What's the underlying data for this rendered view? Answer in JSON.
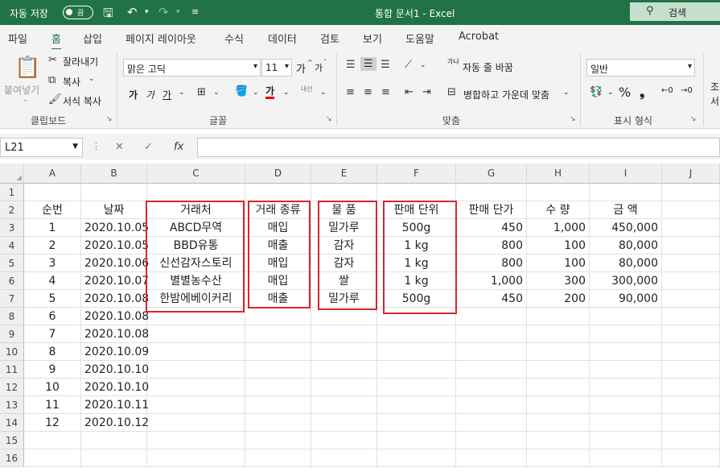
{
  "titlebar": {
    "autosave_label": "자동 저장",
    "autosave_state": "끔",
    "title": "통합 문서1  -  Excel",
    "search": "검색"
  },
  "menu": [
    "파일",
    "홈",
    "삽입",
    "페이지 레이아웃",
    "수식",
    "데이터",
    "검토",
    "보기",
    "도움말",
    "Acrobat"
  ],
  "ribbon": {
    "clipboard": {
      "paste": "붙여넣기",
      "cut": "잘라내기",
      "copy": "복사",
      "format_painter": "서식 복사",
      "group": "클립보드"
    },
    "font": {
      "name": "맑은 고딕",
      "size": "11",
      "bold": "가",
      "italic": "가",
      "underline": "가",
      "font_color": "가",
      "phonetic": "내선",
      "grow": "가",
      "shrink": "가",
      "group": "글꼴"
    },
    "alignment": {
      "wrap": "자동 줄 바꿈",
      "merge": "병합하고 가운데 맞춤",
      "orientation": "가나",
      "group": "맞춤"
    },
    "number": {
      "format": "일반",
      "group": "표시 형식"
    },
    "styles": {
      "partial1": "조",
      "partial2": "서"
    }
  },
  "formula_bar": {
    "name_box": "L21",
    "formula": ""
  },
  "sheet": {
    "columns": [
      "A",
      "B",
      "C",
      "D",
      "E",
      "F",
      "G",
      "H",
      "I",
      "J"
    ],
    "rows": [
      "1",
      "2",
      "3",
      "4",
      "5",
      "6",
      "7",
      "8",
      "9",
      "10",
      "11",
      "12",
      "13",
      "14",
      "15",
      "16"
    ],
    "headers": {
      "A": "순번",
      "B": "날짜",
      "C": "거래처",
      "D": "거래 종류",
      "E": "물 품",
      "F": "판매 단위",
      "G": "판매 단가",
      "H": "수 량",
      "I": "금 액"
    },
    "data": [
      [
        "1",
        "2020.10.05",
        "ABCD무역",
        "매입",
        "밀가루",
        "500g",
        "450",
        "1,000",
        "450,000"
      ],
      [
        "2",
        "2020.10.05",
        "BBD유통",
        "매출",
        "감자",
        "1 kg",
        "800",
        "100",
        "80,000"
      ],
      [
        "3",
        "2020.10.06",
        "신선감자스토리",
        "매입",
        "감자",
        "1 kg",
        "800",
        "100",
        "80,000"
      ],
      [
        "4",
        "2020.10.07",
        "별별농수산",
        "매입",
        "쌀",
        "1 kg",
        "1,000",
        "300",
        "300,000"
      ],
      [
        "5",
        "2020.10.08",
        "한밤에베이커리",
        "매출",
        "밀가루",
        "500g",
        "450",
        "200",
        "90,000"
      ],
      [
        "6",
        "2020.10.08",
        "",
        "",
        "",
        "",
        "",
        "",
        ""
      ],
      [
        "7",
        "2020.10.08",
        "",
        "",
        "",
        "",
        "",
        "",
        ""
      ],
      [
        "8",
        "2020.10.09",
        "",
        "",
        "",
        "",
        "",
        "",
        ""
      ],
      [
        "9",
        "2020.10.10",
        "",
        "",
        "",
        "",
        "",
        "",
        ""
      ],
      [
        "10",
        "2020.10.10",
        "",
        "",
        "",
        "",
        "",
        "",
        ""
      ],
      [
        "11",
        "2020.10.11",
        "",
        "",
        "",
        "",
        "",
        "",
        ""
      ],
      [
        "12",
        "2020.10.12",
        "",
        "",
        "",
        "",
        "",
        "",
        ""
      ]
    ]
  },
  "colors": {
    "accent": "#217346",
    "highlight_box": "#d9262c"
  }
}
